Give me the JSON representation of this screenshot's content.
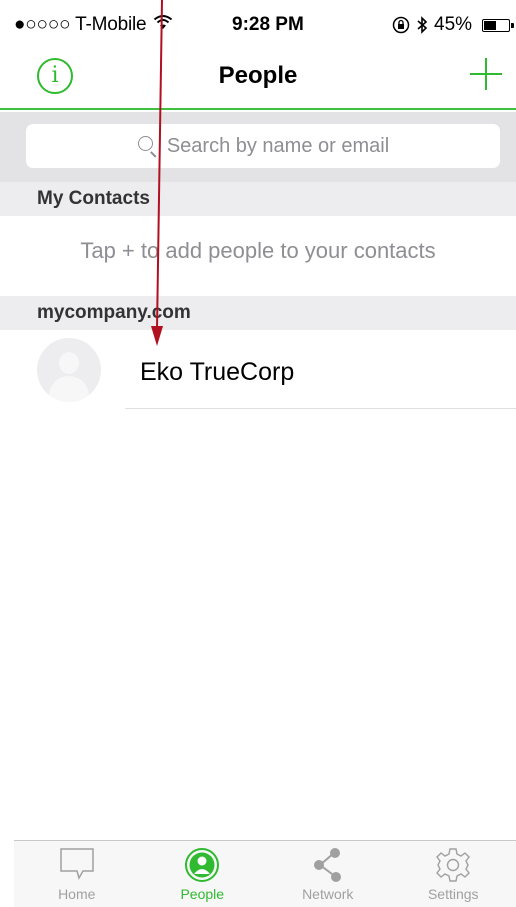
{
  "status_bar": {
    "carrier": "●○○○○ T-Mobile",
    "time": "9:28 PM",
    "battery": "45%",
    "battery_level": 0.45
  },
  "nav": {
    "title": "People",
    "info_glyph": "i"
  },
  "search": {
    "placeholder": "Search by name or email"
  },
  "sections": [
    {
      "title": "My Contacts",
      "empty_hint": "Tap + to add people to your contacts"
    },
    {
      "title": "mycompany.com",
      "contacts": [
        {
          "name": "Eko TrueCorp"
        }
      ]
    }
  ],
  "tabs": [
    {
      "label": "Home",
      "icon": "chat-bubble-icon",
      "active": false
    },
    {
      "label": "People",
      "icon": "person-icon",
      "active": true
    },
    {
      "label": "Network",
      "icon": "share-icon",
      "active": false
    },
    {
      "label": "Settings",
      "icon": "gear-icon",
      "active": false
    }
  ],
  "colors": {
    "accent": "#2fba2f",
    "annotation_arrow": "#b01020",
    "section_bg": "#ededf0",
    "search_bg": "#e3e3e6"
  }
}
